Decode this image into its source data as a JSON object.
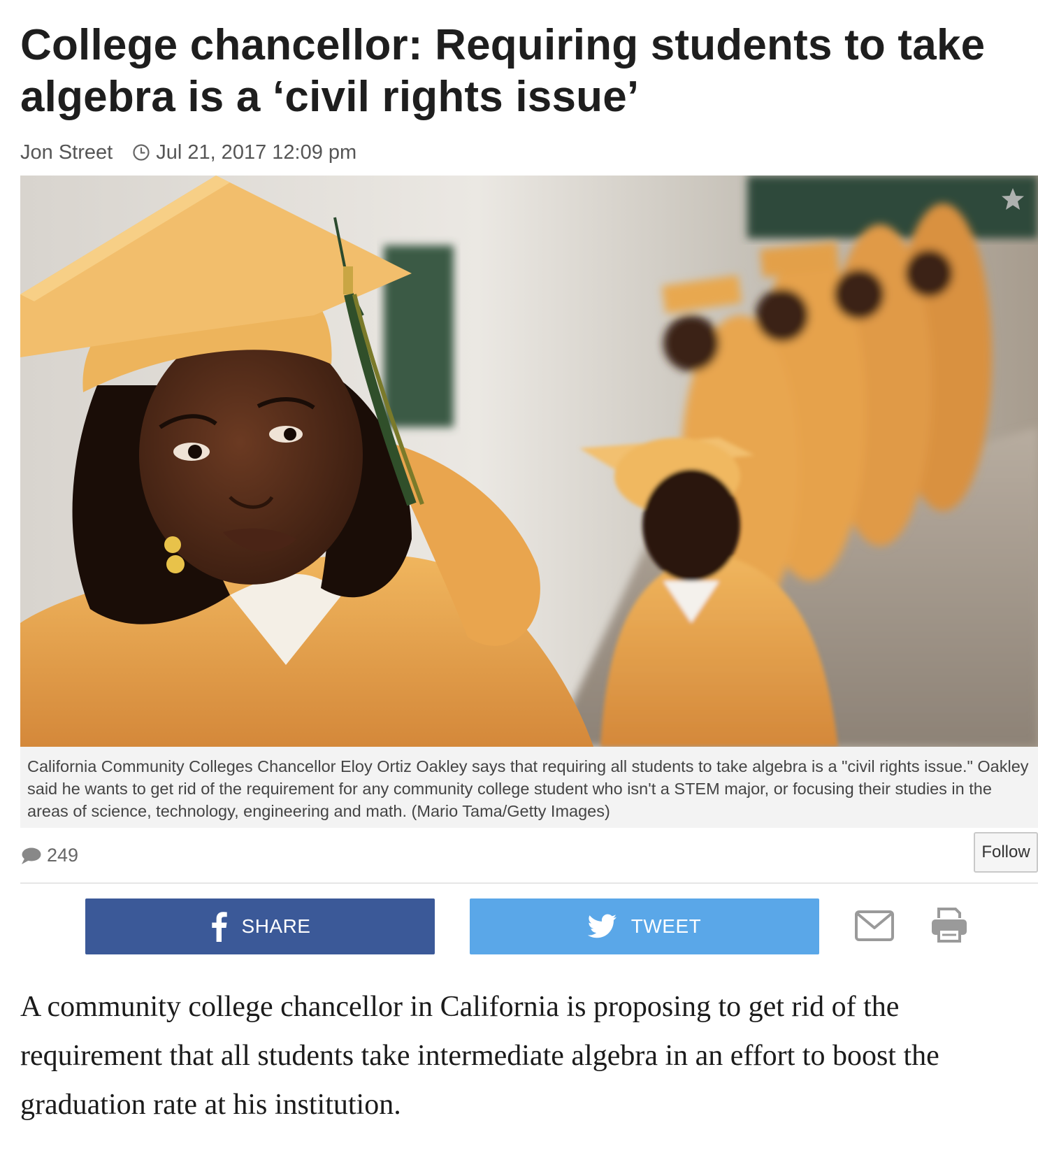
{
  "article": {
    "headline": "College chancellor: Requiring students to take algebra is a ‘civil rights issue’",
    "author": "Jon Street",
    "timestamp": "Jul 21, 2017 12:09 pm",
    "image": {
      "caption": "California Community Colleges Chancellor Eloy Ortiz Oakley says that requiring all students to take algebra is a \"civil rights issue.\" Oakley said he wants to get rid of the requirement for any community college student who isn't a STEM major, or focusing their studies in the areas of science, technology, engineering and math. (Mario Tama/Getty Images)"
    },
    "comments": {
      "count": "249"
    },
    "follow_label": "Follow",
    "share": {
      "facebook_label": "SHARE",
      "twitter_label": "TWEET"
    },
    "body": "A community college chancellor in California is proposing to get rid of the requirement that all students take intermediate algebra in an effort to boost the graduation rate at his institution."
  },
  "icons": {
    "clock": "clock-icon",
    "star": "star-icon",
    "comment": "speech-bubble-icon",
    "facebook": "facebook-icon",
    "twitter": "twitter-bird-icon",
    "email": "envelope-icon",
    "print": "printer-icon"
  },
  "colors": {
    "facebook": "#3b5998",
    "twitter": "#5aa7e8",
    "gown": "#e8a44a"
  }
}
